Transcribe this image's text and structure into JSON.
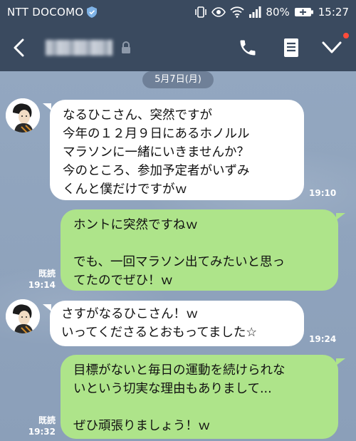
{
  "status": {
    "carrier": "NTT DOCOMO",
    "battery": "80%",
    "time": "15:27"
  },
  "colors": {
    "bar": "#3a4a5f",
    "chat_bg": "#8fa3bd",
    "outgoing_bubble": "#aee48a",
    "incoming_bubble": "#ffffff",
    "badge": "#ff4b3a"
  },
  "icons": [
    "vibrate-icon",
    "eye-icon",
    "wifi-icon",
    "signal-icon",
    "battery-icon",
    "back-icon",
    "lock-icon",
    "phone-icon",
    "memo-icon",
    "chevron-down-icon",
    "shield-icon"
  ],
  "chat": {
    "date": "5月7日(月)",
    "messages": [
      {
        "side": "in",
        "text": "なるひこさん、突然ですが\n今年の１２月９日にあるホノルル\nマラソンに一緒にいきませんか？\n今のところ、参加予定者がいずみ\nくんと僕だけですがｗ",
        "time": "19:10"
      },
      {
        "side": "out",
        "text": "ホントに突然ですねｗ\n\nでも、一回マラソン出てみたいと思っ\nてたのでぜひ！ｗ",
        "read": "既読",
        "time": "19:14"
      },
      {
        "side": "in",
        "text": "さすがなるひこさん！ｗ\nいってくださるとおもってました☆",
        "time": "19:24"
      },
      {
        "side": "out",
        "text": "目標がないと毎日の運動を続けられな\nいという切実な理由もありまして...\n\nぜひ頑張りましょう！ｗ",
        "read": "既読",
        "time": "19:32"
      }
    ]
  }
}
